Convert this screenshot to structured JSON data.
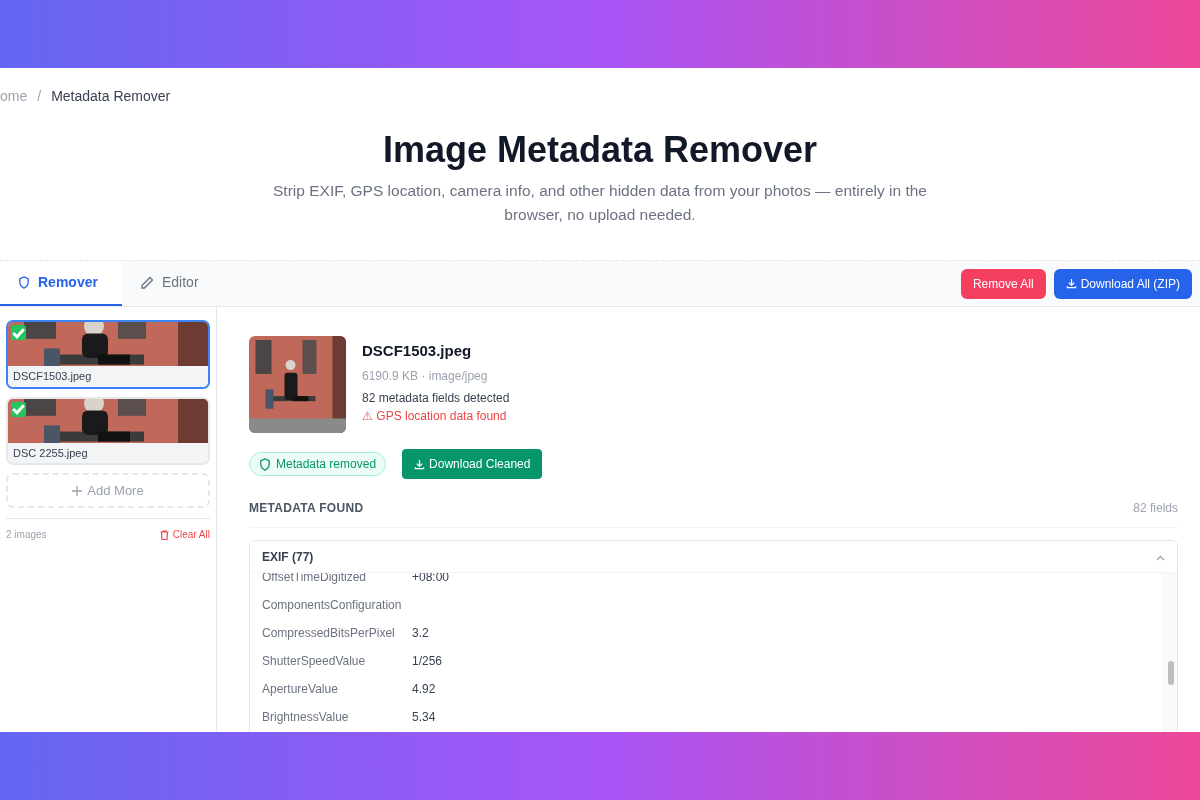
{
  "breadcrumb": {
    "separator": "/",
    "items": [
      {
        "label": "ome",
        "current": false
      },
      {
        "label": "Metadata Remover",
        "current": true
      }
    ]
  },
  "header": {
    "title": "Image Metadata Remover",
    "subtitle": "Strip EXIF, GPS location, camera info, and other hidden data from your photos — entirely in the browser, no upload needed."
  },
  "tabs": [
    {
      "label": "Remover",
      "selected": true
    },
    {
      "label": "Editor",
      "selected": false
    }
  ],
  "toolbar": {
    "remove_all": "Remove All",
    "download_all": "Download All (ZIP)"
  },
  "sidebar": {
    "images": [
      {
        "name": "DSCF1503.jpeg",
        "checked": true,
        "selected": true,
        "kind": "picture"
      },
      {
        "name": "DSC 2255.jpeg",
        "checked": true,
        "selected": false,
        "kind": "picture"
      }
    ],
    "add_more": "Add More",
    "count": "2 images",
    "clear_all": "Clear All"
  },
  "file": {
    "name": "DSCF1503.jpeg",
    "info": "6190.9 KB · image/jpeg",
    "fields": "82 metadata fields detected",
    "warning": "⚠ GPS location data found",
    "status": "Metadata removed",
    "download": "Download Cleaned"
  },
  "metadata": {
    "heading": "METADATA FOUND",
    "count": "82 fields",
    "sections": [
      {
        "title": "EXIF (77)",
        "expanded": true,
        "rows": [
          {
            "key": "OffsetTimeDigitized",
            "value": "+08:00"
          },
          {
            "key": "ComponentsConfiguration"
          },
          {
            "key": "CompressedBitsPerPixel",
            "value": "3.2"
          },
          {
            "key": "ShutterSpeedValue",
            "value": "1/256"
          },
          {
            "key": "ApertureValue",
            "value": "4.92"
          },
          {
            "key": "BrightnessValue",
            "value": "5.34"
          }
        ]
      }
    ]
  }
}
